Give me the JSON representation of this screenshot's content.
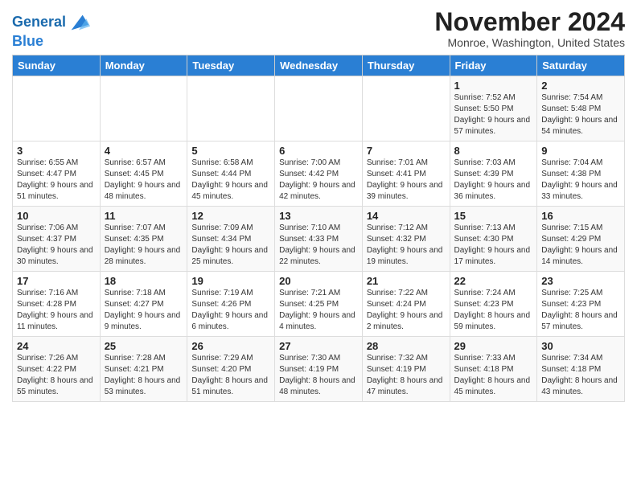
{
  "header": {
    "logo_line1": "General",
    "logo_line2": "Blue",
    "month_title": "November 2024",
    "subtitle": "Monroe, Washington, United States"
  },
  "weekdays": [
    "Sunday",
    "Monday",
    "Tuesday",
    "Wednesday",
    "Thursday",
    "Friday",
    "Saturday"
  ],
  "weeks": [
    [
      {
        "day": "",
        "info": ""
      },
      {
        "day": "",
        "info": ""
      },
      {
        "day": "",
        "info": ""
      },
      {
        "day": "",
        "info": ""
      },
      {
        "day": "",
        "info": ""
      },
      {
        "day": "1",
        "info": "Sunrise: 7:52 AM\nSunset: 5:50 PM\nDaylight: 9 hours and 57 minutes."
      },
      {
        "day": "2",
        "info": "Sunrise: 7:54 AM\nSunset: 5:48 PM\nDaylight: 9 hours and 54 minutes."
      }
    ],
    [
      {
        "day": "3",
        "info": "Sunrise: 6:55 AM\nSunset: 4:47 PM\nDaylight: 9 hours and 51 minutes."
      },
      {
        "day": "4",
        "info": "Sunrise: 6:57 AM\nSunset: 4:45 PM\nDaylight: 9 hours and 48 minutes."
      },
      {
        "day": "5",
        "info": "Sunrise: 6:58 AM\nSunset: 4:44 PM\nDaylight: 9 hours and 45 minutes."
      },
      {
        "day": "6",
        "info": "Sunrise: 7:00 AM\nSunset: 4:42 PM\nDaylight: 9 hours and 42 minutes."
      },
      {
        "day": "7",
        "info": "Sunrise: 7:01 AM\nSunset: 4:41 PM\nDaylight: 9 hours and 39 minutes."
      },
      {
        "day": "8",
        "info": "Sunrise: 7:03 AM\nSunset: 4:39 PM\nDaylight: 9 hours and 36 minutes."
      },
      {
        "day": "9",
        "info": "Sunrise: 7:04 AM\nSunset: 4:38 PM\nDaylight: 9 hours and 33 minutes."
      }
    ],
    [
      {
        "day": "10",
        "info": "Sunrise: 7:06 AM\nSunset: 4:37 PM\nDaylight: 9 hours and 30 minutes."
      },
      {
        "day": "11",
        "info": "Sunrise: 7:07 AM\nSunset: 4:35 PM\nDaylight: 9 hours and 28 minutes."
      },
      {
        "day": "12",
        "info": "Sunrise: 7:09 AM\nSunset: 4:34 PM\nDaylight: 9 hours and 25 minutes."
      },
      {
        "day": "13",
        "info": "Sunrise: 7:10 AM\nSunset: 4:33 PM\nDaylight: 9 hours and 22 minutes."
      },
      {
        "day": "14",
        "info": "Sunrise: 7:12 AM\nSunset: 4:32 PM\nDaylight: 9 hours and 19 minutes."
      },
      {
        "day": "15",
        "info": "Sunrise: 7:13 AM\nSunset: 4:30 PM\nDaylight: 9 hours and 17 minutes."
      },
      {
        "day": "16",
        "info": "Sunrise: 7:15 AM\nSunset: 4:29 PM\nDaylight: 9 hours and 14 minutes."
      }
    ],
    [
      {
        "day": "17",
        "info": "Sunrise: 7:16 AM\nSunset: 4:28 PM\nDaylight: 9 hours and 11 minutes."
      },
      {
        "day": "18",
        "info": "Sunrise: 7:18 AM\nSunset: 4:27 PM\nDaylight: 9 hours and 9 minutes."
      },
      {
        "day": "19",
        "info": "Sunrise: 7:19 AM\nSunset: 4:26 PM\nDaylight: 9 hours and 6 minutes."
      },
      {
        "day": "20",
        "info": "Sunrise: 7:21 AM\nSunset: 4:25 PM\nDaylight: 9 hours and 4 minutes."
      },
      {
        "day": "21",
        "info": "Sunrise: 7:22 AM\nSunset: 4:24 PM\nDaylight: 9 hours and 2 minutes."
      },
      {
        "day": "22",
        "info": "Sunrise: 7:24 AM\nSunset: 4:23 PM\nDaylight: 8 hours and 59 minutes."
      },
      {
        "day": "23",
        "info": "Sunrise: 7:25 AM\nSunset: 4:23 PM\nDaylight: 8 hours and 57 minutes."
      }
    ],
    [
      {
        "day": "24",
        "info": "Sunrise: 7:26 AM\nSunset: 4:22 PM\nDaylight: 8 hours and 55 minutes."
      },
      {
        "day": "25",
        "info": "Sunrise: 7:28 AM\nSunset: 4:21 PM\nDaylight: 8 hours and 53 minutes."
      },
      {
        "day": "26",
        "info": "Sunrise: 7:29 AM\nSunset: 4:20 PM\nDaylight: 8 hours and 51 minutes."
      },
      {
        "day": "27",
        "info": "Sunrise: 7:30 AM\nSunset: 4:19 PM\nDaylight: 8 hours and 48 minutes."
      },
      {
        "day": "28",
        "info": "Sunrise: 7:32 AM\nSunset: 4:19 PM\nDaylight: 8 hours and 47 minutes."
      },
      {
        "day": "29",
        "info": "Sunrise: 7:33 AM\nSunset: 4:18 PM\nDaylight: 8 hours and 45 minutes."
      },
      {
        "day": "30",
        "info": "Sunrise: 7:34 AM\nSunset: 4:18 PM\nDaylight: 8 hours and 43 minutes."
      }
    ]
  ]
}
